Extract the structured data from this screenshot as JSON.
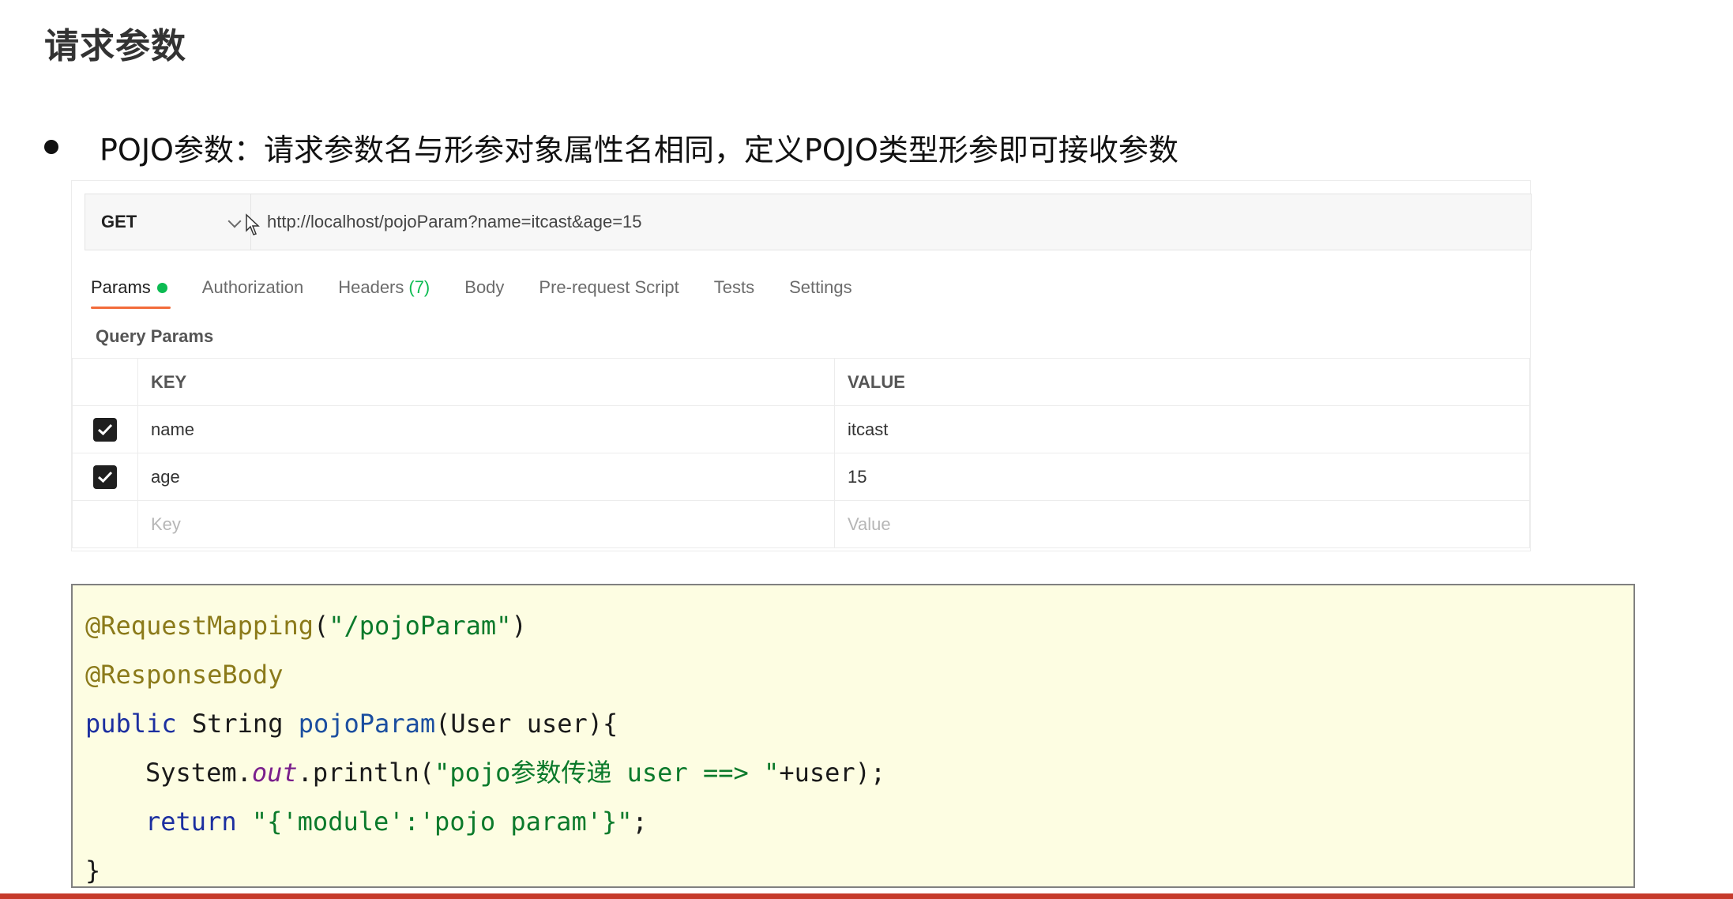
{
  "slide": {
    "title": "请求参数",
    "bullet": "POJO参数：请求参数名与形参对象属性名相同，定义POJO类型形参即可接收参数"
  },
  "request": {
    "method": "GET",
    "url": "http://localhost/pojoParam?name=itcast&age=15"
  },
  "tabs": [
    {
      "label": "Params",
      "active": true,
      "dot_color": "#0cbb52"
    },
    {
      "label": "Authorization"
    },
    {
      "label": "Headers",
      "count": "(7)"
    },
    {
      "label": "Body"
    },
    {
      "label": "Pre-request Script"
    },
    {
      "label": "Tests"
    },
    {
      "label": "Settings"
    }
  ],
  "query_params": {
    "label": "Query Params",
    "headers": {
      "key": "KEY",
      "value": "VALUE"
    },
    "rows": [
      {
        "checked": true,
        "key": "name",
        "value": "itcast"
      },
      {
        "checked": true,
        "key": "age",
        "value": "15"
      }
    ],
    "placeholder": {
      "key": "Key",
      "value": "Value"
    }
  },
  "code": {
    "line1": {
      "annotation": "@RequestMapping",
      "open": "(",
      "string": "\"/pojoParam\"",
      "close": ")"
    },
    "line2": {
      "annotation": "@ResponseBody"
    },
    "line3": {
      "keyword": "public",
      "type": " String ",
      "method": "pojoParam",
      "rest": "(User user){"
    },
    "line4": {
      "prefix": "System.",
      "field": "out",
      "call": ".println(",
      "string": "\"pojo参数传递 user ==> \"",
      "rest": "+user);"
    },
    "line5": {
      "keyword": "return",
      "space": " ",
      "string": "\"{'module':'pojo param'}\"",
      "rest": ";"
    },
    "line6": {
      "text": "}"
    }
  },
  "colors": {
    "accent_orange": "#f26b3a",
    "status_green": "#0cbb52",
    "code_background": "#fdfde2",
    "bottom_strip": "#c63a2b"
  }
}
